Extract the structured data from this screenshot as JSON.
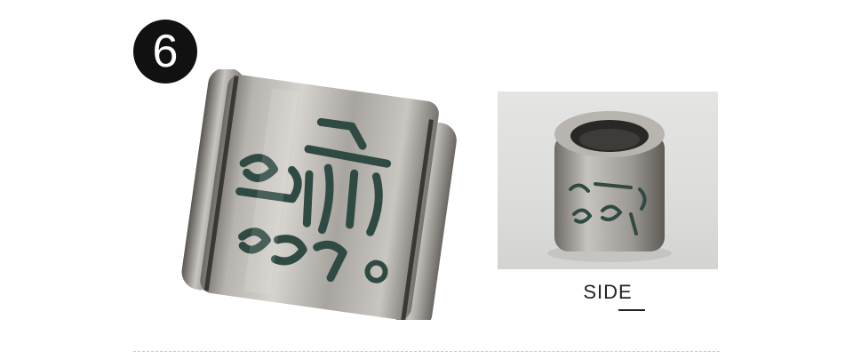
{
  "badge": {
    "number": "6"
  },
  "side_view": {
    "caption": "SIDE"
  },
  "colors": {
    "badge_bg": "#111111",
    "silver": "#a9a6a2",
    "engraving_dark": "#2f4a42"
  }
}
